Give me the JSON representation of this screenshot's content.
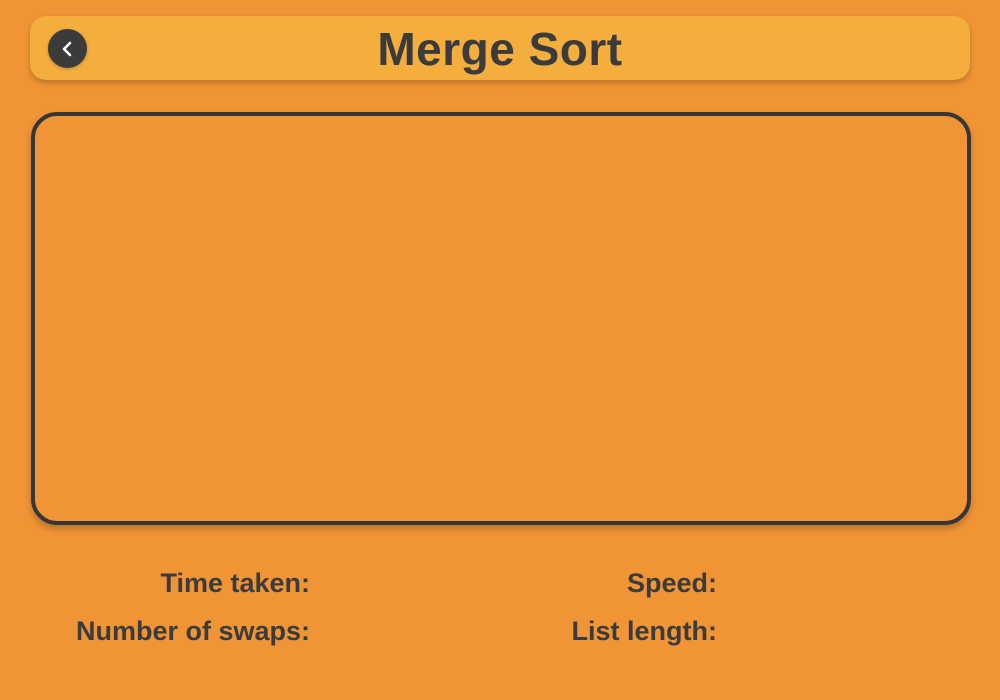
{
  "header": {
    "title": "Merge Sort",
    "back_icon": "chevron-left-icon"
  },
  "colors": {
    "background": "#f09436",
    "header_bar": "#f3ae3e",
    "text": "#3b3b3b",
    "panel_border": "#363636"
  },
  "stats": {
    "time_taken_label": "Time taken:",
    "time_taken_value": "",
    "swaps_label": "Number of swaps:",
    "swaps_value": "",
    "speed_label": "Speed:",
    "speed_value": "",
    "list_length_label": "List length:",
    "list_length_value": ""
  }
}
